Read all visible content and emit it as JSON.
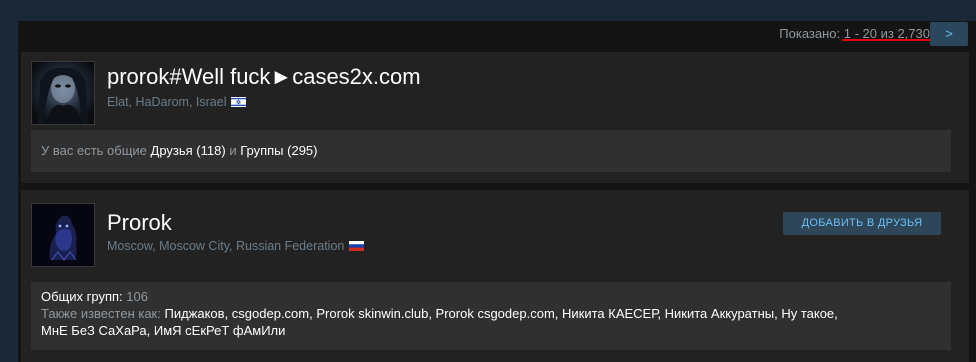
{
  "paging": {
    "label": "Показано:",
    "range": "1 - 20 из 2,730",
    "next": ">"
  },
  "results": [
    {
      "name": "prorok#Well fuck►cases2x.com",
      "location": "Elat, HaDarom, Israel",
      "flag": "israel-flag",
      "common_prefix": "У вас есть общие",
      "friends": "Друзья (118)",
      "and": "и",
      "groups": "Группы (295)"
    },
    {
      "name": "Prorok",
      "location": "Moscow, Moscow City, Russian Federation",
      "flag": "russia-flag",
      "add_friend": "ДОБАВИТЬ В ДРУЗЬЯ",
      "common_groups_label": "Общих групп:",
      "common_groups_value": "106",
      "aka_label": "Также известен как:",
      "aka_names": "Пиджаков, csgodep.com, Prorok skinwin.club, Prorok csgodep.com, Никита КАЕСЕР, Никита Аккуратны, Ну такое,",
      "aka_names_2": "МнЕ БеЗ СаХаРа, ИмЯ сЕкРеТ фАмИли"
    }
  ],
  "colors": {
    "accent": "#67c1f5",
    "underline": "#e60000",
    "background": "#1b2838"
  }
}
